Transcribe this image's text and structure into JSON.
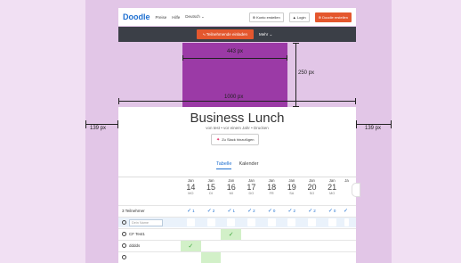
{
  "topbar": {
    "logo": "Doodle",
    "nav": [
      "Preise",
      "Hilfe",
      "Deutsch ⌄"
    ],
    "create_account": "⊕ Konto erstellen",
    "login": "▲ Login",
    "create_doodle": "⊕ Doodle erstellen"
  },
  "toolbar": {
    "simplify": "⤷ Teilnehmende einladen",
    "more": "Mehr ⌄"
  },
  "measure": {
    "w443": "443 px",
    "h250": "250 px",
    "w1000": "1000 px",
    "left": "139 px",
    "right": "139 px"
  },
  "poll": {
    "title": "Business Lunch",
    "subtitle": "von test • vor einem Jahr • Drucken",
    "add_slack": "Zu Slack hinzufügen"
  },
  "tabs": [
    "Tabelle",
    "Kalender"
  ],
  "dates": [
    {
      "mon": "Jan",
      "day": "14",
      "wd": "MO"
    },
    {
      "mon": "Jan",
      "day": "15",
      "wd": "DI"
    },
    {
      "mon": "Jan",
      "day": "16",
      "wd": "MI"
    },
    {
      "mon": "Jan",
      "day": "17",
      "wd": "DO"
    },
    {
      "mon": "Jan",
      "day": "18",
      "wd": "FR"
    },
    {
      "mon": "Jan",
      "day": "19",
      "wd": "SA"
    },
    {
      "mon": "Jan",
      "day": "20",
      "wd": "SO"
    },
    {
      "mon": "Jan",
      "day": "21",
      "wd": "MO"
    },
    {
      "mon": "Ja",
      "day": "",
      "wd": ""
    }
  ],
  "summary": {
    "label": "3 Teilnehmer",
    "counts": [
      "1",
      "2",
      "1",
      "2",
      "0",
      "2",
      "2",
      "0",
      ""
    ]
  },
  "input_row": {
    "placeholder": "Dein Name"
  },
  "participants": [
    {
      "name": "CF Test1",
      "yes": [
        false,
        false,
        true,
        false,
        false,
        false,
        false,
        false
      ]
    },
    {
      "name": "dddds",
      "yes": [
        true,
        false,
        false,
        false,
        false,
        false,
        false,
        false
      ]
    },
    {
      "name": "",
      "yes": [
        false,
        true,
        false,
        false,
        false,
        false,
        false,
        false
      ]
    }
  ],
  "colors": {
    "accent": "#1e6fd0",
    "brand_red": "#e4572e",
    "purple": "#9b3aa6",
    "yes_green": "#d2f0c8"
  }
}
